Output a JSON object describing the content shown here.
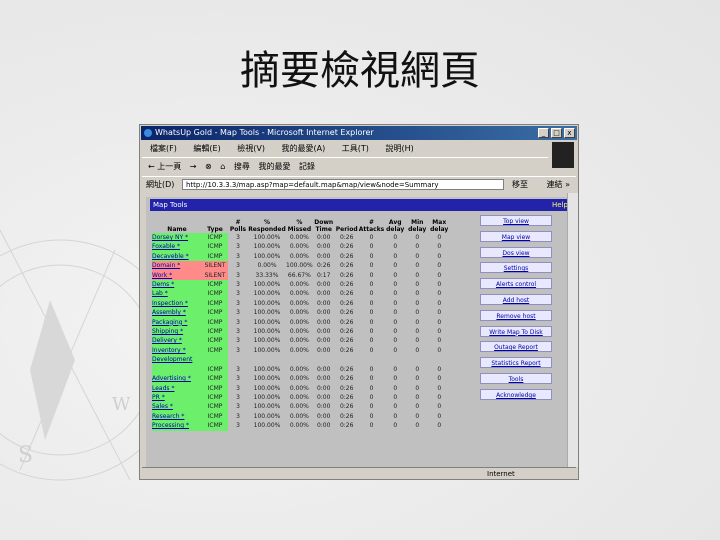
{
  "slide": {
    "title": "摘要檢視網頁"
  },
  "window": {
    "title": "WhatsUp Gold - Map Tools - Microsoft Internet Explorer",
    "controls": [
      "_",
      "□",
      "x"
    ]
  },
  "menubar": [
    "檔案(F)",
    "編輯(E)",
    "檢視(V)",
    "我的最愛(A)",
    "工具(T)",
    "說明(H)"
  ],
  "toolbar": [
    "← 上一頁",
    "→",
    "⊗",
    "⌂",
    "搜尋",
    "我的最愛",
    "記錄"
  ],
  "address": {
    "label": "網址(D)",
    "url": "http://10.3.3.3/map.asp?map=default.map&map/view&node=Summary",
    "go": "移至",
    "links": "連結 »"
  },
  "app": {
    "title": "Map Tools",
    "help": "Help"
  },
  "table": {
    "headers": [
      "Name",
      "Type",
      "# Polls",
      "% Responded",
      "% Missed",
      "Down Time",
      "Period",
      "# Attacks",
      "Avg delay",
      "Min delay",
      "Max delay"
    ],
    "rows": [
      {
        "name": "Dorsey NY *",
        "type": "ICMP",
        "polls": "3",
        "resp": "100.00%",
        "miss": "0.00%",
        "down": "0:00",
        "period": "0:26",
        "att": "0",
        "avg": "0",
        "min": "0",
        "max": "0",
        "status": "ok"
      },
      {
        "name": "Foxable *",
        "type": "ICMP",
        "polls": "3",
        "resp": "100.00%",
        "miss": "0.00%",
        "down": "0:00",
        "period": "0:26",
        "att": "0",
        "avg": "0",
        "min": "0",
        "max": "0",
        "status": "ok"
      },
      {
        "name": "Decaveble *",
        "type": "ICMP",
        "polls": "3",
        "resp": "100.00%",
        "miss": "0.00%",
        "down": "0:00",
        "period": "0:26",
        "att": "0",
        "avg": "0",
        "min": "0",
        "max": "0",
        "status": "ok"
      },
      {
        "name": "Domain *",
        "type": "SILENT",
        "polls": "3",
        "resp": "0.00%",
        "miss": "100.00%",
        "down": "0:26",
        "period": "0:26",
        "att": "0",
        "avg": "0",
        "min": "0",
        "max": "0",
        "status": "bad"
      },
      {
        "name": "Work *",
        "type": "SILENT",
        "polls": "3",
        "resp": "33.33%",
        "miss": "66.67%",
        "down": "0:17",
        "period": "0:26",
        "att": "0",
        "avg": "0",
        "min": "0",
        "max": "0",
        "status": "bad"
      },
      {
        "name": "Dems *",
        "type": "ICMP",
        "polls": "3",
        "resp": "100.00%",
        "miss": "0.00%",
        "down": "0:00",
        "period": "0:26",
        "att": "0",
        "avg": "0",
        "min": "0",
        "max": "0",
        "status": "ok"
      },
      {
        "name": "Lab *",
        "type": "ICMP",
        "polls": "3",
        "resp": "100.00%",
        "miss": "0.00%",
        "down": "0:00",
        "period": "0:26",
        "att": "0",
        "avg": "0",
        "min": "0",
        "max": "0",
        "status": "ok"
      },
      {
        "name": "Inspection *",
        "type": "ICMP",
        "polls": "3",
        "resp": "100.00%",
        "miss": "0.00%",
        "down": "0:00",
        "period": "0:26",
        "att": "0",
        "avg": "0",
        "min": "0",
        "max": "0",
        "status": "ok"
      },
      {
        "name": "Assembly *",
        "type": "ICMP",
        "polls": "3",
        "resp": "100.00%",
        "miss": "0.00%",
        "down": "0:00",
        "period": "0:26",
        "att": "0",
        "avg": "0",
        "min": "0",
        "max": "0",
        "status": "ok"
      },
      {
        "name": "Packaging *",
        "type": "ICMP",
        "polls": "3",
        "resp": "100.00%",
        "miss": "0.00%",
        "down": "0:00",
        "period": "0:26",
        "att": "0",
        "avg": "0",
        "min": "0",
        "max": "0",
        "status": "ok"
      },
      {
        "name": "Shipping *",
        "type": "ICMP",
        "polls": "3",
        "resp": "100.00%",
        "miss": "0.00%",
        "down": "0:00",
        "period": "0:26",
        "att": "0",
        "avg": "0",
        "min": "0",
        "max": "0",
        "status": "ok"
      },
      {
        "name": "Delivery *",
        "type": "ICMP",
        "polls": "3",
        "resp": "100.00%",
        "miss": "0.00%",
        "down": "0:00",
        "period": "0:26",
        "att": "0",
        "avg": "0",
        "min": "0",
        "max": "0",
        "status": "ok"
      },
      {
        "name": "Inventory *",
        "type": "ICMP",
        "polls": "3",
        "resp": "100.00%",
        "miss": "0.00%",
        "down": "0:00",
        "period": "0:26",
        "att": "0",
        "avg": "0",
        "min": "0",
        "max": "0",
        "status": "ok"
      },
      {
        "name": "Development",
        "type": "",
        "polls": "",
        "resp": "",
        "miss": "",
        "down": "",
        "period": "",
        "att": "",
        "avg": "",
        "min": "",
        "max": "",
        "status": "ok"
      },
      {
        "name": "",
        "type": "ICMP",
        "polls": "3",
        "resp": "100.00%",
        "miss": "0.00%",
        "down": "0:00",
        "period": "0:26",
        "att": "0",
        "avg": "0",
        "min": "0",
        "max": "0",
        "status": "ok"
      },
      {
        "name": "Advertising *",
        "type": "ICMP",
        "polls": "3",
        "resp": "100.00%",
        "miss": "0.00%",
        "down": "0:00",
        "period": "0:26",
        "att": "0",
        "avg": "0",
        "min": "0",
        "max": "0",
        "status": "ok"
      },
      {
        "name": "Leads *",
        "type": "ICMP",
        "polls": "3",
        "resp": "100.00%",
        "miss": "0.00%",
        "down": "0:00",
        "period": "0:26",
        "att": "0",
        "avg": "0",
        "min": "0",
        "max": "0",
        "status": "ok"
      },
      {
        "name": "PR *",
        "type": "ICMP",
        "polls": "3",
        "resp": "100.00%",
        "miss": "0.00%",
        "down": "0:00",
        "period": "0:26",
        "att": "0",
        "avg": "0",
        "min": "0",
        "max": "0",
        "status": "ok"
      },
      {
        "name": "Sales *",
        "type": "ICMP",
        "polls": "3",
        "resp": "100.00%",
        "miss": "0.00%",
        "down": "0:00",
        "period": "0:26",
        "att": "0",
        "avg": "0",
        "min": "0",
        "max": "0",
        "status": "ok"
      },
      {
        "name": "Research *",
        "type": "ICMP",
        "polls": "3",
        "resp": "100.00%",
        "miss": "0.00%",
        "down": "0:00",
        "period": "0:26",
        "att": "0",
        "avg": "0",
        "min": "0",
        "max": "0",
        "status": "ok"
      },
      {
        "name": "Processing *",
        "type": "ICMP",
        "polls": "3",
        "resp": "100.00%",
        "miss": "0.00%",
        "down": "0:00",
        "period": "0:26",
        "att": "0",
        "avg": "0",
        "min": "0",
        "max": "0",
        "status": "ok"
      }
    ]
  },
  "side_buttons": [
    "Top view",
    "Map view",
    "Dos view",
    "Settings",
    "Alerts control",
    "Add host",
    "Remove host",
    "Write Map To Disk",
    "Outage Report",
    "Statistics Report",
    "Tools",
    "Acknowledge"
  ],
  "status": {
    "left": "",
    "zone": "Internet"
  },
  "colors": {
    "ok": "#6cf06c",
    "bad": "#ff8a8a",
    "header_bar": "#2222aa"
  }
}
